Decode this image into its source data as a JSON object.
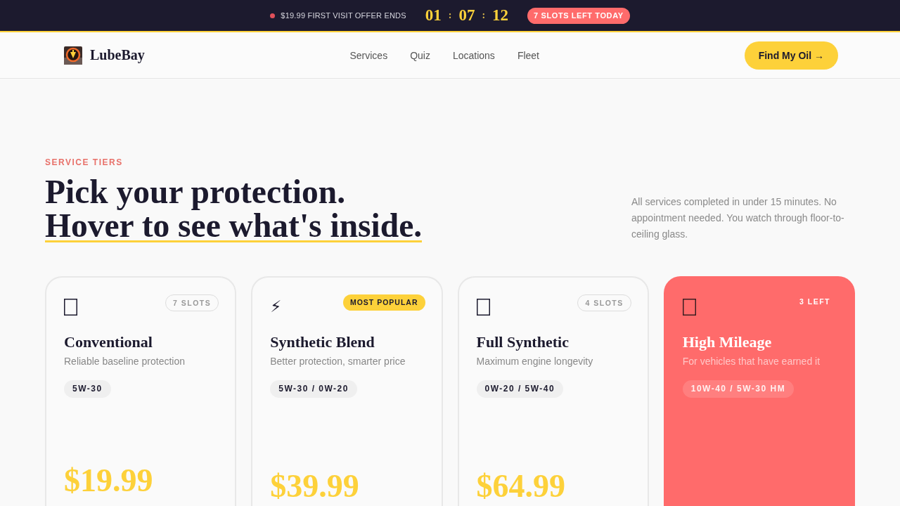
{
  "promo_bar": {
    "offer": "$19.99 FIRST VISIT OFFER ENDS",
    "timer": [
      "01",
      ":",
      "07",
      ":",
      "12"
    ],
    "badge": "7 SLOTS LEFT TODAY"
  },
  "nav": {
    "brand": "LubeBay",
    "links": [
      "Services",
      "Quiz",
      "Locations",
      "Fleet"
    ],
    "cta": "Find My Oil →"
  },
  "section": {
    "eyebrow": "SERVICE TIERS",
    "heading": "Pick your protection.",
    "heading_underlined": "Hover to see what's inside.",
    "intro": "All services completed in under 15 minutes. No appointment needed. You watch through floor-to-ceiling glass."
  },
  "tiers": [
    {
      "badge": {
        "kind": "slots",
        "text": "7 SLOTS"
      },
      "name": "Conventional",
      "tagline": "Reliable baseline protection",
      "oil": "5W-30",
      "price": "$19.99",
      "featured": false
    },
    {
      "icon": "⚡",
      "badge": {
        "kind": "popular",
        "text": "MOST POPULAR"
      },
      "name": "Synthetic Blend",
      "tagline": "Better protection, smarter price",
      "oil": "5W-30 / 0W-20",
      "price": "$39.99",
      "featured": false
    },
    {
      "badge": {
        "kind": "slots",
        "text": "4 SLOTS"
      },
      "name": "Full Synthetic",
      "tagline": "Maximum engine longevity",
      "oil": "0W-20 / 5W-40",
      "price": "$64.99",
      "featured": false
    },
    {
      "badge": {
        "kind": "left",
        "text": "3 LEFT"
      },
      "name": "High Mileage",
      "tagline": "For vehicles that have earned it",
      "oil": "10W-40 / 5W-30 HM",
      "featured": true
    }
  ]
}
